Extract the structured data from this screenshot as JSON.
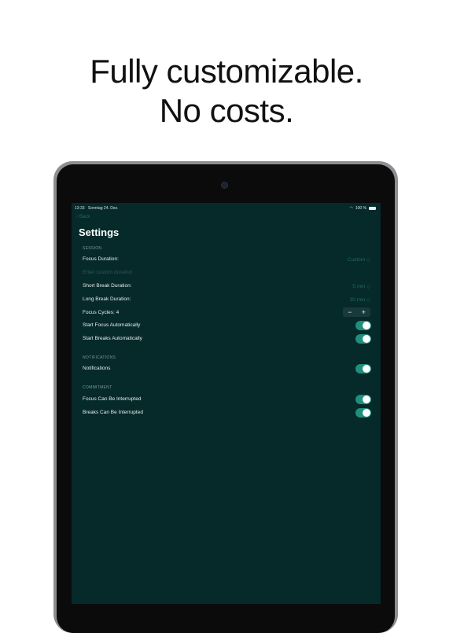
{
  "headline": {
    "line1": "Fully customizable.",
    "line2": "No costs."
  },
  "status_bar": {
    "time": "13:33",
    "date": "Sonntag 24. Dez.",
    "battery": "100 %"
  },
  "nav": {
    "back_label": "Back"
  },
  "page_title": "Settings",
  "sections": {
    "session": {
      "header": "SESSION",
      "focus_duration": {
        "label": "Focus Duration:",
        "value": "Custom ◇"
      },
      "custom_duration_placeholder": "Enter custom duration",
      "short_break": {
        "label": "Short Break Duration:",
        "value": "5 min ◇"
      },
      "long_break": {
        "label": "Long Break Duration:",
        "value": "30 min ◇"
      },
      "focus_cycles": {
        "label": "Focus Cycles: 4",
        "minus": "−",
        "plus": "+"
      },
      "start_focus_auto": {
        "label": "Start Focus Automatically",
        "on": true
      },
      "start_breaks_auto": {
        "label": "Start Breaks Automatically",
        "on": true
      }
    },
    "notifications": {
      "header": "NOTIFICATIONS",
      "notifications": {
        "label": "Notifications",
        "on": true
      }
    },
    "commitment": {
      "header": "COMMITMENT",
      "focus_interrupted": {
        "label": "Focus Can Be Interrupted",
        "on": true
      },
      "breaks_interrupted": {
        "label": "Breaks Can Be Interrupted",
        "on": true
      }
    }
  },
  "colors": {
    "background": "#06292a",
    "accent": "#1f8f7b",
    "link": "#1f6a64"
  }
}
